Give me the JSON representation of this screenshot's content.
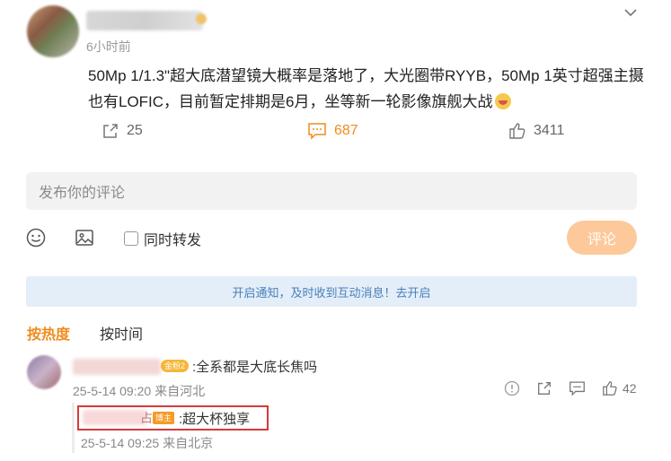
{
  "post": {
    "time": "6小时前",
    "text": "50Mp 1/1.3\"超大底潜望镜大概率是落地了，大光圈带RYYB，50Mp 1英寸超强主摄也有LOFIC，目前暂定排期是6月，坐等新一轮影像旗舰大战",
    "shares": "25",
    "comments": "687",
    "likes": "3411"
  },
  "composer": {
    "placeholder": "发布你的评论",
    "repost_label": "同时转发",
    "submit_label": "评论"
  },
  "notice": "开启通知，及时收到互动消息！去开启",
  "sort": {
    "hot": "按热度",
    "time": "按时间"
  },
  "comment": {
    "badge": "金粉2",
    "text": ":全系都是大底长焦吗",
    "time": "25-5-14 09:20 来自河北",
    "likes": "42"
  },
  "reply": {
    "name_tail": "占",
    "badge": "博主",
    "text": ":超大杯独享",
    "time": "25-5-14 09:25 来自北京"
  },
  "colors": {
    "accent": "#ef8c1c",
    "notice_bg": "#e3eef9",
    "highlight": "#d43a3a"
  }
}
